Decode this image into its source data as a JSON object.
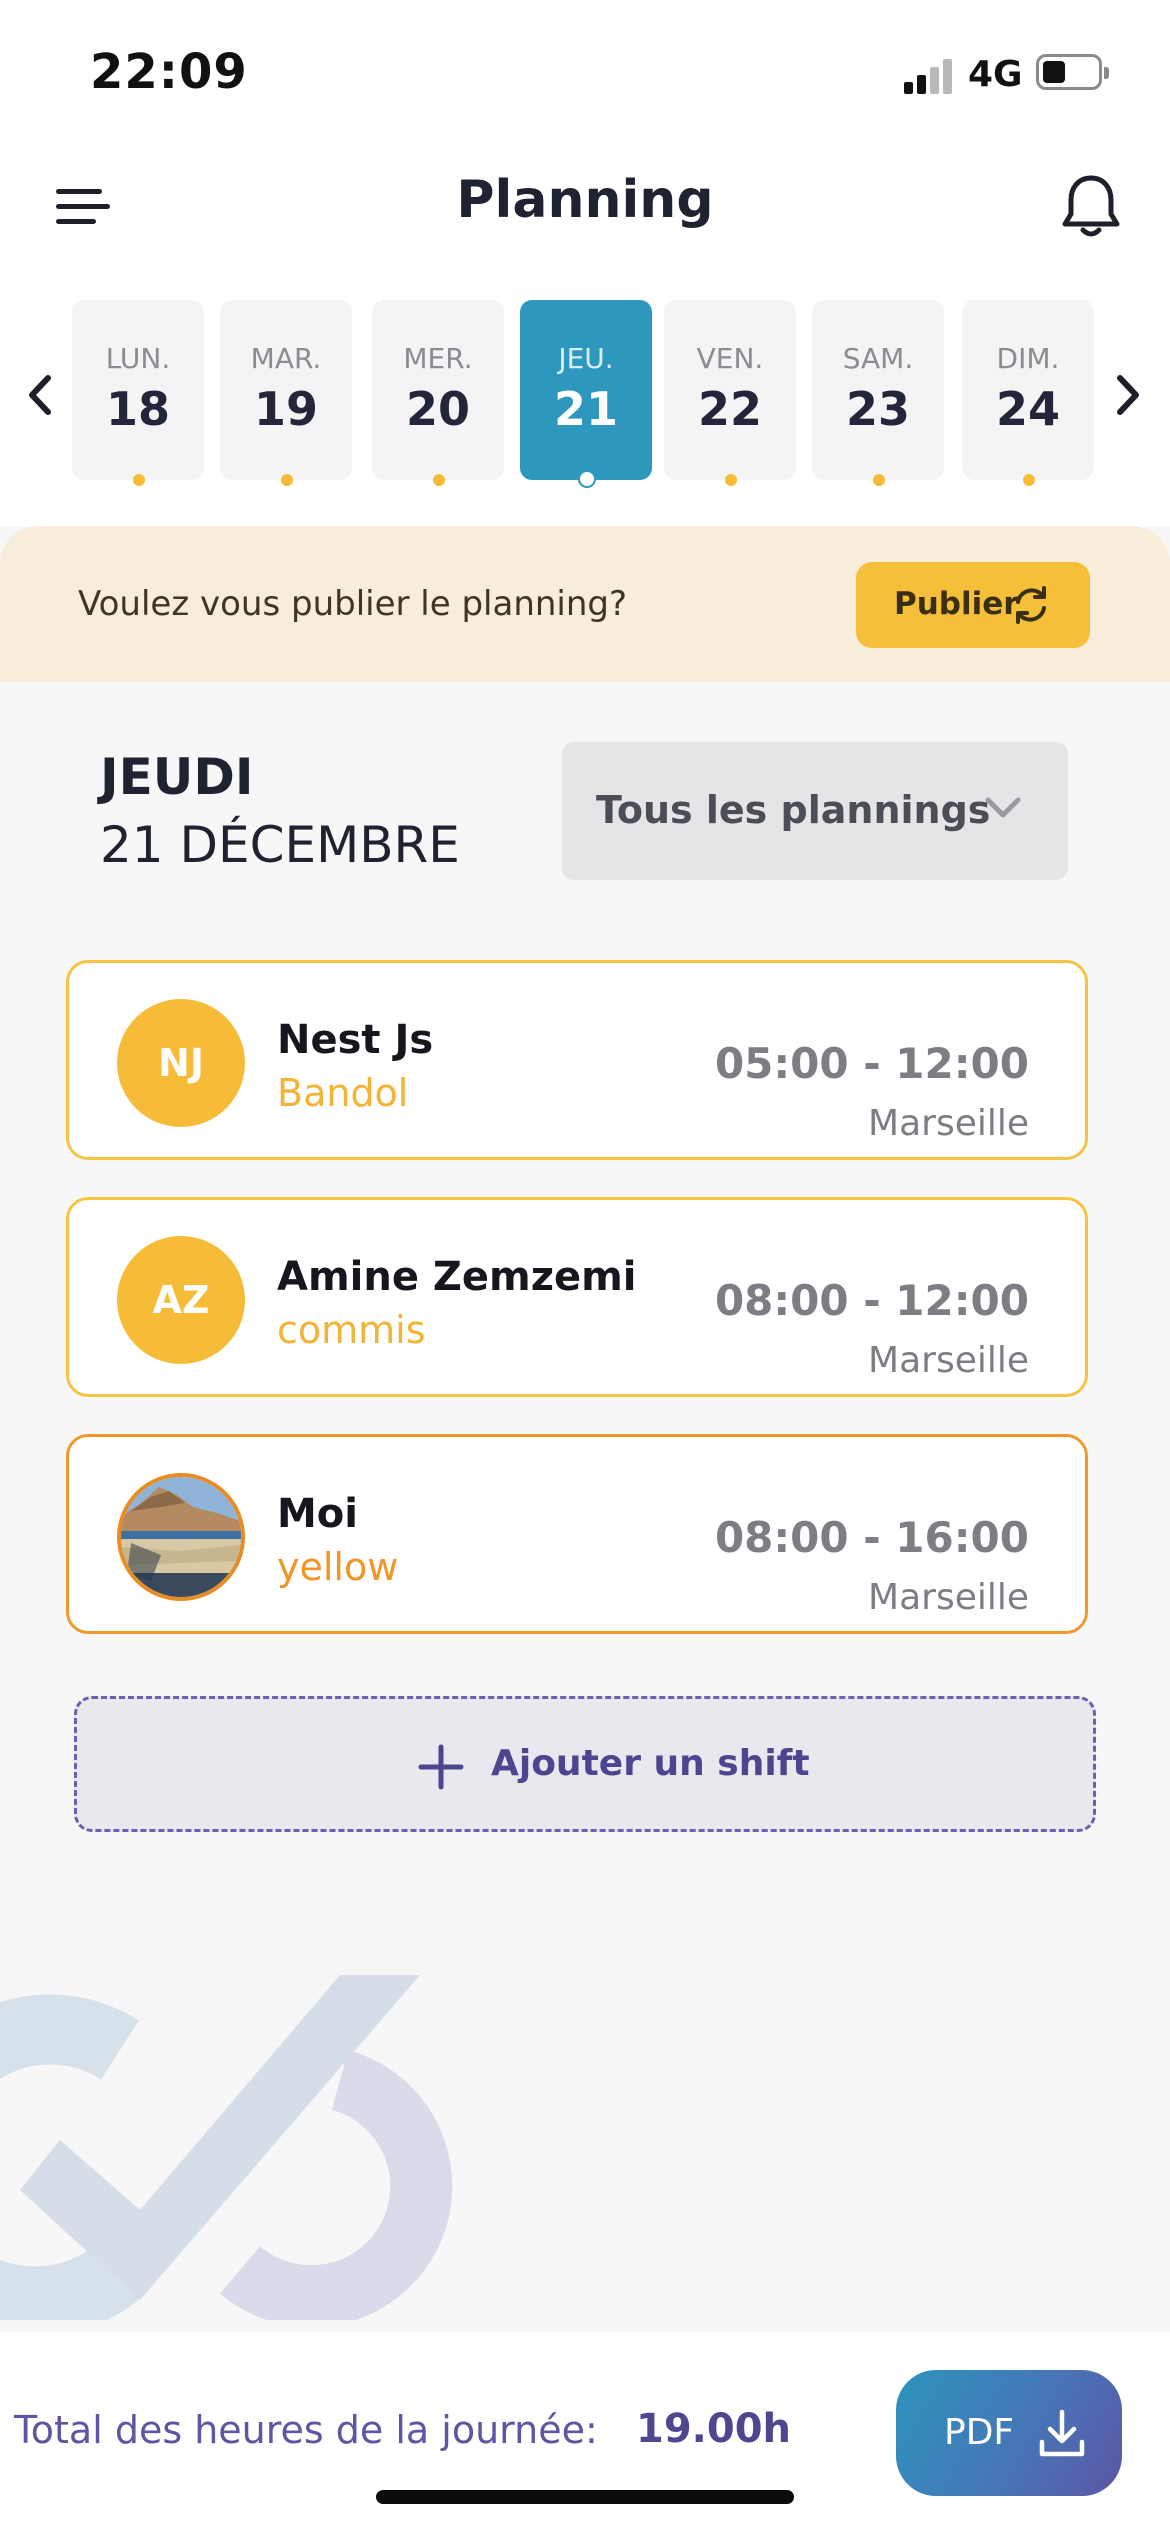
{
  "status_bar": {
    "time": "22:09",
    "network": "4G",
    "battery_level": 0.35
  },
  "header": {
    "title": "Planning",
    "menu_icon": "hamburger-menu-icon",
    "notification_icon": "bell-icon"
  },
  "week": {
    "prev_icon": "chevron-left-icon",
    "next_icon": "chevron-right-icon",
    "days": [
      {
        "name": "LUN.",
        "date": "18"
      },
      {
        "name": "MAR.",
        "date": "19"
      },
      {
        "name": "MER.",
        "date": "20"
      },
      {
        "name": "JEU.",
        "date": "21",
        "selected": true
      },
      {
        "name": "VEN.",
        "date": "22"
      },
      {
        "name": "SAM.",
        "date": "23"
      },
      {
        "name": "DIM.",
        "date": "24"
      }
    ]
  },
  "publish_banner": {
    "text": "Voulez vous publier le planning?",
    "button_label": "Publier",
    "button_icon": "refresh-icon"
  },
  "selected_day": {
    "weekday": "JEUDI",
    "date": "21 DÉCEMBRE"
  },
  "filter": {
    "selected": "Tous les plannings",
    "icon": "chevron-down-icon"
  },
  "shifts": [
    {
      "initials": "NJ",
      "name": "Nest Js",
      "role": "Bandol",
      "hours": "05:00 - 12:00",
      "location": "Marseille"
    },
    {
      "initials": "AZ",
      "name": "Amine Zemzemi",
      "role": "commis",
      "hours": "08:00 - 12:00",
      "location": "Marseille"
    },
    {
      "initials": "",
      "name": "Moi",
      "role": "yellow",
      "hours": "08:00 - 16:00",
      "location": "Marseille",
      "avatar": "photo"
    }
  ],
  "add_shift": {
    "label": "Ajouter un shift",
    "icon": "plus-icon"
  },
  "footer": {
    "total_label": "Total des heures de la journée:",
    "total_value": "19.00h",
    "pdf_label": "PDF",
    "pdf_icon": "download-icon"
  },
  "colors": {
    "accent_blue": "#2e97bd",
    "accent_yellow": "#f6bc38",
    "accent_purple": "#5c55a5",
    "banner_bg": "#f8ecda"
  }
}
